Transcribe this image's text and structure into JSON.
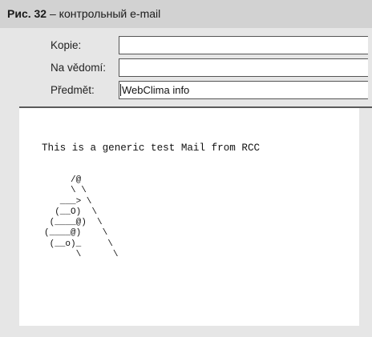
{
  "caption": {
    "number": "Рис. 32",
    "separator": " – ",
    "title": "контрольный e-mail"
  },
  "header_fields": [
    {
      "label": "Kopie:",
      "value": ""
    },
    {
      "label": "Na vědomí:",
      "value": ""
    },
    {
      "label": "Předmět:",
      "value": "WebClima info"
    }
  ],
  "message": {
    "body_text": "This is a generic test Mail from RCC",
    "ascii_art": "     /@\n     \\ \\\n   ___> \\\n  (__O)  \\\n (____@)  \\\n(____@)    \\\n (__o)_     \\\n      \\      \\"
  },
  "colors": {
    "figure_background": "#e6e6e6",
    "caption_background": "#d2d2d2",
    "message_background": "#ffffff"
  }
}
